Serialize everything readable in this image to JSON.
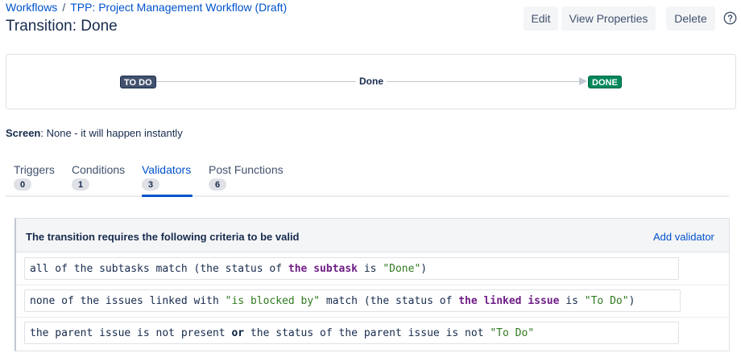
{
  "breadcrumb": {
    "root": "Workflows",
    "separator": "/",
    "current": "TPP: Project Management Workflow (Draft)"
  },
  "page_title": "Transition: Done",
  "toolbar": {
    "edit_label": "Edit",
    "view_properties_label": "View Properties",
    "delete_label": "Delete",
    "help_icon": "question-circle-icon"
  },
  "diagram": {
    "from_status": "TO DO",
    "transition_name": "Done",
    "to_status": "DONE",
    "colors": {
      "todo": "#42526e",
      "done": "#00875a"
    }
  },
  "screen": {
    "label": "Screen",
    "value": ": None - it will happen instantly"
  },
  "tabs": [
    {
      "label": "Triggers",
      "count": "0",
      "active": false
    },
    {
      "label": "Conditions",
      "count": "1",
      "active": false
    },
    {
      "label": "Validators",
      "count": "3",
      "active": true
    },
    {
      "label": "Post Functions",
      "count": "6",
      "active": false
    }
  ],
  "validators": {
    "header": "The transition requires the following criteria to be valid",
    "add_label": "Add validator",
    "rules": [
      {
        "parts": [
          {
            "t": "all of the subtasks match (the status of ",
            "c": "plain"
          },
          {
            "t": "the subtask",
            "c": "kw"
          },
          {
            "t": " is ",
            "c": "plain"
          },
          {
            "t": "\"Done\"",
            "c": "str"
          },
          {
            "t": ")",
            "c": "plain"
          }
        ]
      },
      {
        "parts": [
          {
            "t": "none of the issues linked with ",
            "c": "plain"
          },
          {
            "t": "\"is blocked by\"",
            "c": "str"
          },
          {
            "t": " match (the status of ",
            "c": "plain"
          },
          {
            "t": "the linked issue",
            "c": "kw"
          },
          {
            "t": " is ",
            "c": "plain"
          },
          {
            "t": "\"To Do\"",
            "c": "str"
          },
          {
            "t": ")",
            "c": "plain"
          }
        ]
      },
      {
        "parts": [
          {
            "t": "the parent issue is not present ",
            "c": "plain"
          },
          {
            "t": "or",
            "c": "kw-blue"
          },
          {
            "t": " the status of the parent issue is not ",
            "c": "plain"
          },
          {
            "t": "\"To Do\"",
            "c": "str"
          }
        ]
      }
    ]
  },
  "colors": {
    "link": "#0052cc",
    "text": "#172b4d"
  }
}
